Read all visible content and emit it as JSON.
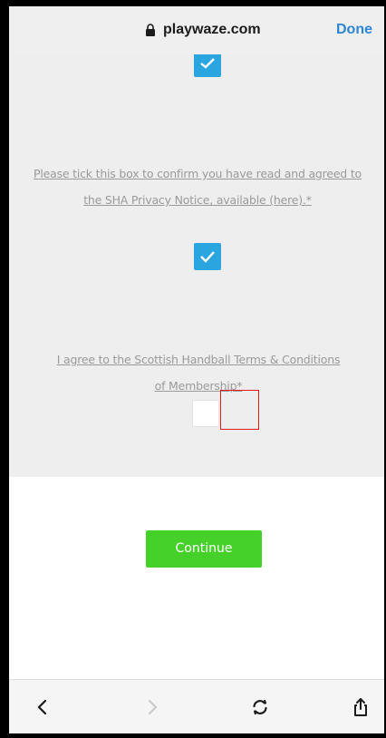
{
  "browser": {
    "url": "playwaze.com",
    "done_label": "Done"
  },
  "form": {
    "top_checkbox_checked": true,
    "privacy_notice_text": "Please tick this box to confirm you have read and agreed to the SHA Privacy Notice, available (here).*",
    "privacy_checkbox_checked": true,
    "terms_text": "I agree to the Scottish Handball Terms & Conditions of Membership*",
    "terms_checkbox_checked": false
  },
  "continue_label": "Continue",
  "toolbar": {
    "icons": [
      "back-icon",
      "forward-icon",
      "reload-icon",
      "share-icon"
    ]
  },
  "colors": {
    "checkbox": "#2aa5e0",
    "continue": "#45d12a",
    "done": "#2f86d6",
    "highlight": "#e21b1b"
  }
}
